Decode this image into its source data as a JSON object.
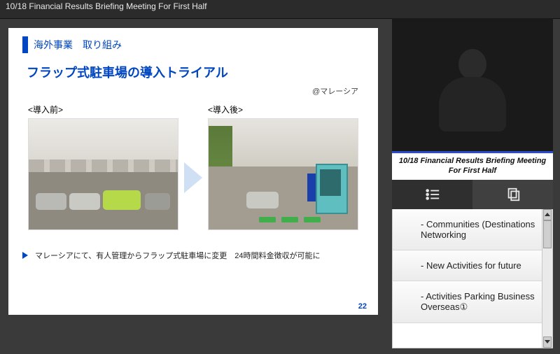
{
  "titlebar": "10/18 Financial Results Briefing Meeting For First Half",
  "slide": {
    "section": "海外事業　取り組み",
    "title": "フラップ式駐車場の導入トライアル",
    "location": "@マレーシア",
    "before_label": "<導入前>",
    "after_label": "<導入後>",
    "note": "マレーシアにて、有人管理からフラップ式駐車場に変更　24時間料金徴収が可能に",
    "page_number": "22"
  },
  "video_caption": "10/18 Financial Results Briefing Meeting For First Half",
  "outline_items": [
    "- Communities (Destinations Networking",
    "- New Activities for future",
    "- Activities Parking Business Overseas①"
  ]
}
